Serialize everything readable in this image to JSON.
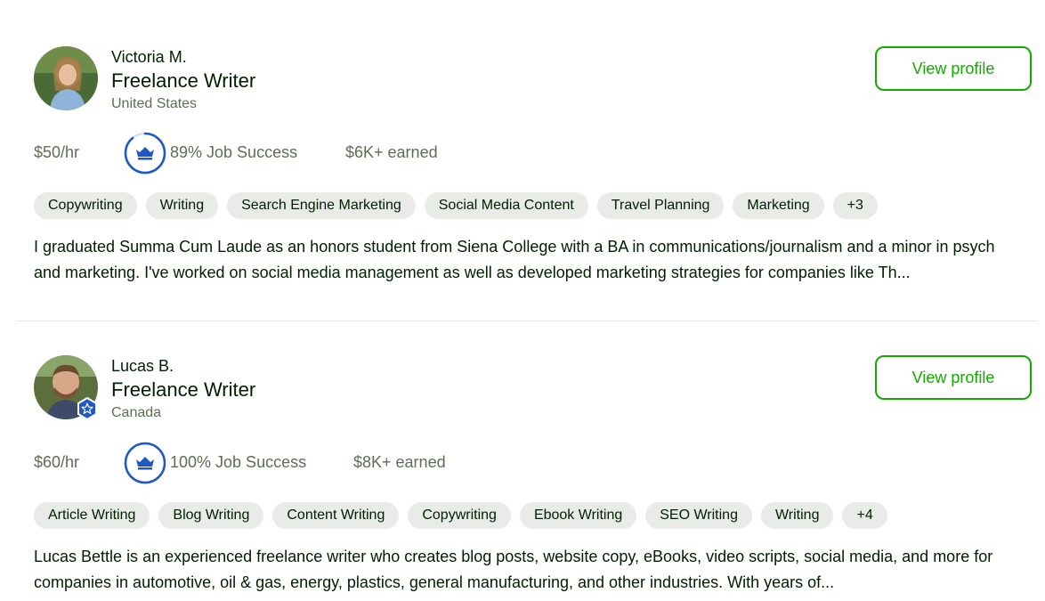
{
  "colors": {
    "accent_green": "#14a800",
    "jss_blue": "#1f57c3",
    "muted_text": "#5e6d55",
    "chip_bg": "#e9ebe9"
  },
  "freelancers": [
    {
      "name": "Victoria M.",
      "title": "Freelance Writer",
      "location": "United States",
      "view_label": "View profile",
      "rate": "$50/hr",
      "job_success": "89% Job Success",
      "job_success_value": 0.89,
      "earned": "$6K+ earned",
      "skills": [
        "Copywriting",
        "Writing",
        "Search Engine Marketing",
        "Social Media Content",
        "Travel Planning",
        "Marketing",
        "+3"
      ],
      "description": "I graduated Summa Cum Laude as an honors student from Siena College with a BA in communications/journalism and a minor in psych and marketing. I've worked on social media management as well as developed marketing strategies for companies like Th...",
      "icons": {
        "jss": "crown-icon"
      }
    },
    {
      "name": "Lucas B.",
      "title": "Freelance Writer",
      "location": "Canada",
      "view_label": "View profile",
      "rate": "$60/hr",
      "job_success": "100% Job Success",
      "job_success_value": 1.0,
      "earned": "$8K+ earned",
      "skills": [
        "Article Writing",
        "Blog Writing",
        "Content Writing",
        "Copywriting",
        "Ebook Writing",
        "SEO Writing",
        "Writing",
        "+4"
      ],
      "description": "Lucas Bettle is an experienced freelance writer who creates blog posts, website copy, eBooks, video scripts, social media, and more for companies in automotive, oil & gas, energy, plastics, general manufacturing, and other industries. With years of...",
      "icons": {
        "jss": "crown-icon",
        "badge": "star-badge-icon"
      }
    }
  ]
}
